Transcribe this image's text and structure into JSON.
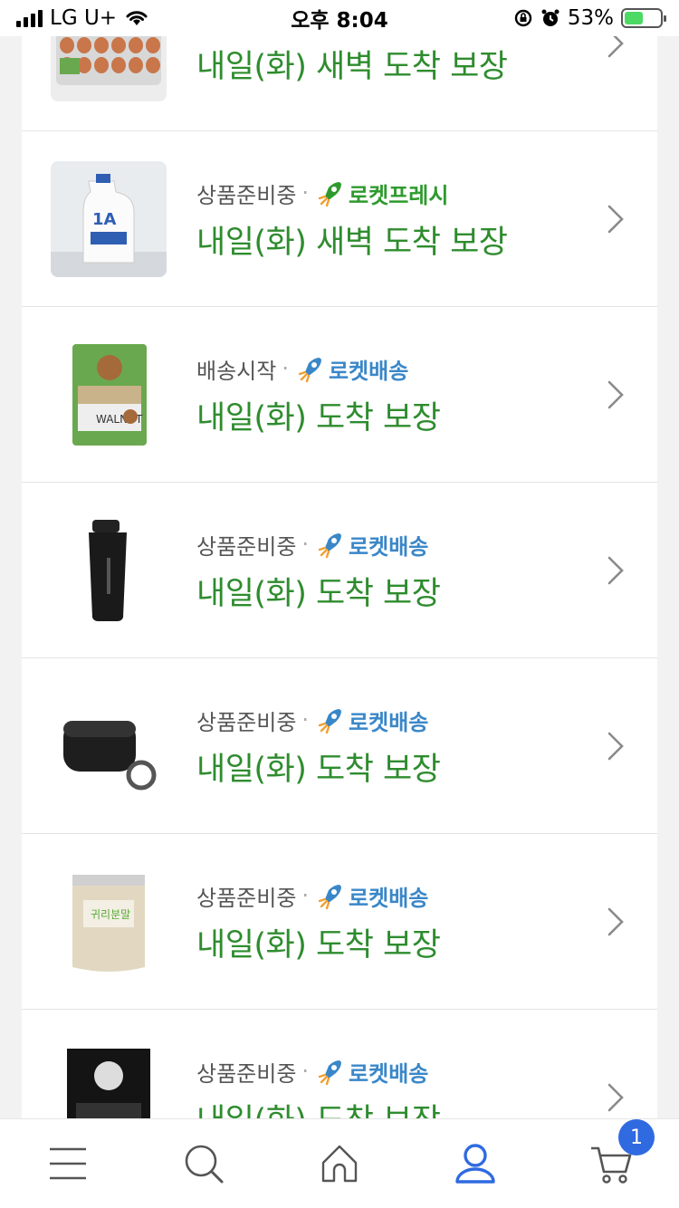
{
  "status_bar": {
    "carrier": "LG U+",
    "time": "오후 8:04",
    "battery_percent": "53%",
    "battery_level": 0.53
  },
  "items": [
    {
      "status": "",
      "badge": "",
      "badge_type": "fresh",
      "arrival": "내일(화) 새벽 도착 보장",
      "image": "eggs"
    },
    {
      "status": "상품준비중",
      "badge": "로켓프레시",
      "badge_type": "fresh",
      "arrival": "내일(화) 새벽 도착 보장",
      "image": "milk"
    },
    {
      "status": "배송시작",
      "badge": "로켓배송",
      "badge_type": "rocket",
      "arrival": "내일(화) 도착 보장",
      "image": "walnut"
    },
    {
      "status": "상품준비중",
      "badge": "로켓배송",
      "badge_type": "rocket",
      "arrival": "내일(화) 도착 보장",
      "image": "shaker"
    },
    {
      "status": "상품준비중",
      "badge": "로켓배송",
      "badge_type": "rocket",
      "arrival": "내일(화) 도착 보장",
      "image": "case"
    },
    {
      "status": "상품준비중",
      "badge": "로켓배송",
      "badge_type": "rocket",
      "arrival": "내일(화) 도착 보장",
      "image": "powder"
    },
    {
      "status": "상품준비중",
      "badge": "로켓배송",
      "badge_type": "rocket",
      "arrival": "내일(화) 도착 보장",
      "image": "coffee"
    }
  ],
  "bottom_nav": {
    "items": [
      "menu-icon",
      "search-icon",
      "home-icon",
      "user-icon",
      "cart-icon"
    ],
    "cart_count": "1",
    "active_color": "#2f6ae0"
  },
  "colors": {
    "arrival_green": "#2e8c2e",
    "fresh_green": "#2e9a2e",
    "rocket_blue": "#3a87c8"
  }
}
